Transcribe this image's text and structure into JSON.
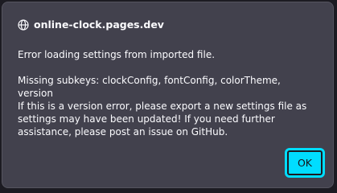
{
  "dialog": {
    "origin": "online-clock.pages.dev",
    "origin_icon": "globe-icon",
    "message_line1": "Error loading settings from imported file.",
    "message_line2": "Missing subkeys: clockConfig, fontConfig, colorTheme, version",
    "message_line3": "If this is a version error, please export a new settings file as settings may have been updated! If you need further assistance, please post an issue on GitHub.",
    "ok_label": "OK"
  },
  "colors": {
    "dialog_background": "#42414d",
    "page_background": "#1c1b22",
    "accent": "#00ddff",
    "text": "#fbfbfe"
  }
}
